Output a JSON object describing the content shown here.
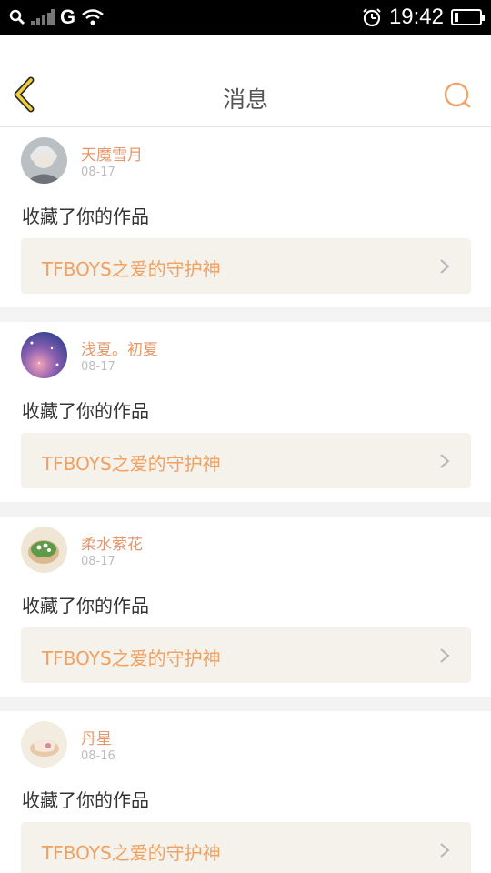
{
  "status_bar": {
    "network": "G",
    "time": "19:42"
  },
  "header": {
    "title": "消息"
  },
  "messages": [
    {
      "user": "天魔雪月",
      "date": "08-17",
      "action": "收藏了你的作品",
      "work": "TFBOYS之爱的守护神"
    },
    {
      "user": "浅夏。初夏",
      "date": "08-17",
      "action": "收藏了你的作品",
      "work": "TFBOYS之爱的守护神"
    },
    {
      "user": "柔水萦花",
      "date": "08-17",
      "action": "收藏了你的作品",
      "work": "TFBOYS之爱的守护神"
    },
    {
      "user": "丹星",
      "date": "08-16",
      "action": "收藏了你的作品",
      "work": "TFBOYS之爱的守护神"
    }
  ],
  "colors": {
    "accent": "#e8976a",
    "work_title": "#f0a061",
    "work_bg": "#f4f2ea",
    "back_arrow": "#e9c12e",
    "search": "#f2a468"
  },
  "icons": [
    "search-icon",
    "signal-icon",
    "wifi-icon",
    "alarm-icon",
    "battery-icon",
    "back-arrow-icon",
    "search-ring-icon",
    "chevron-right-icon"
  ]
}
